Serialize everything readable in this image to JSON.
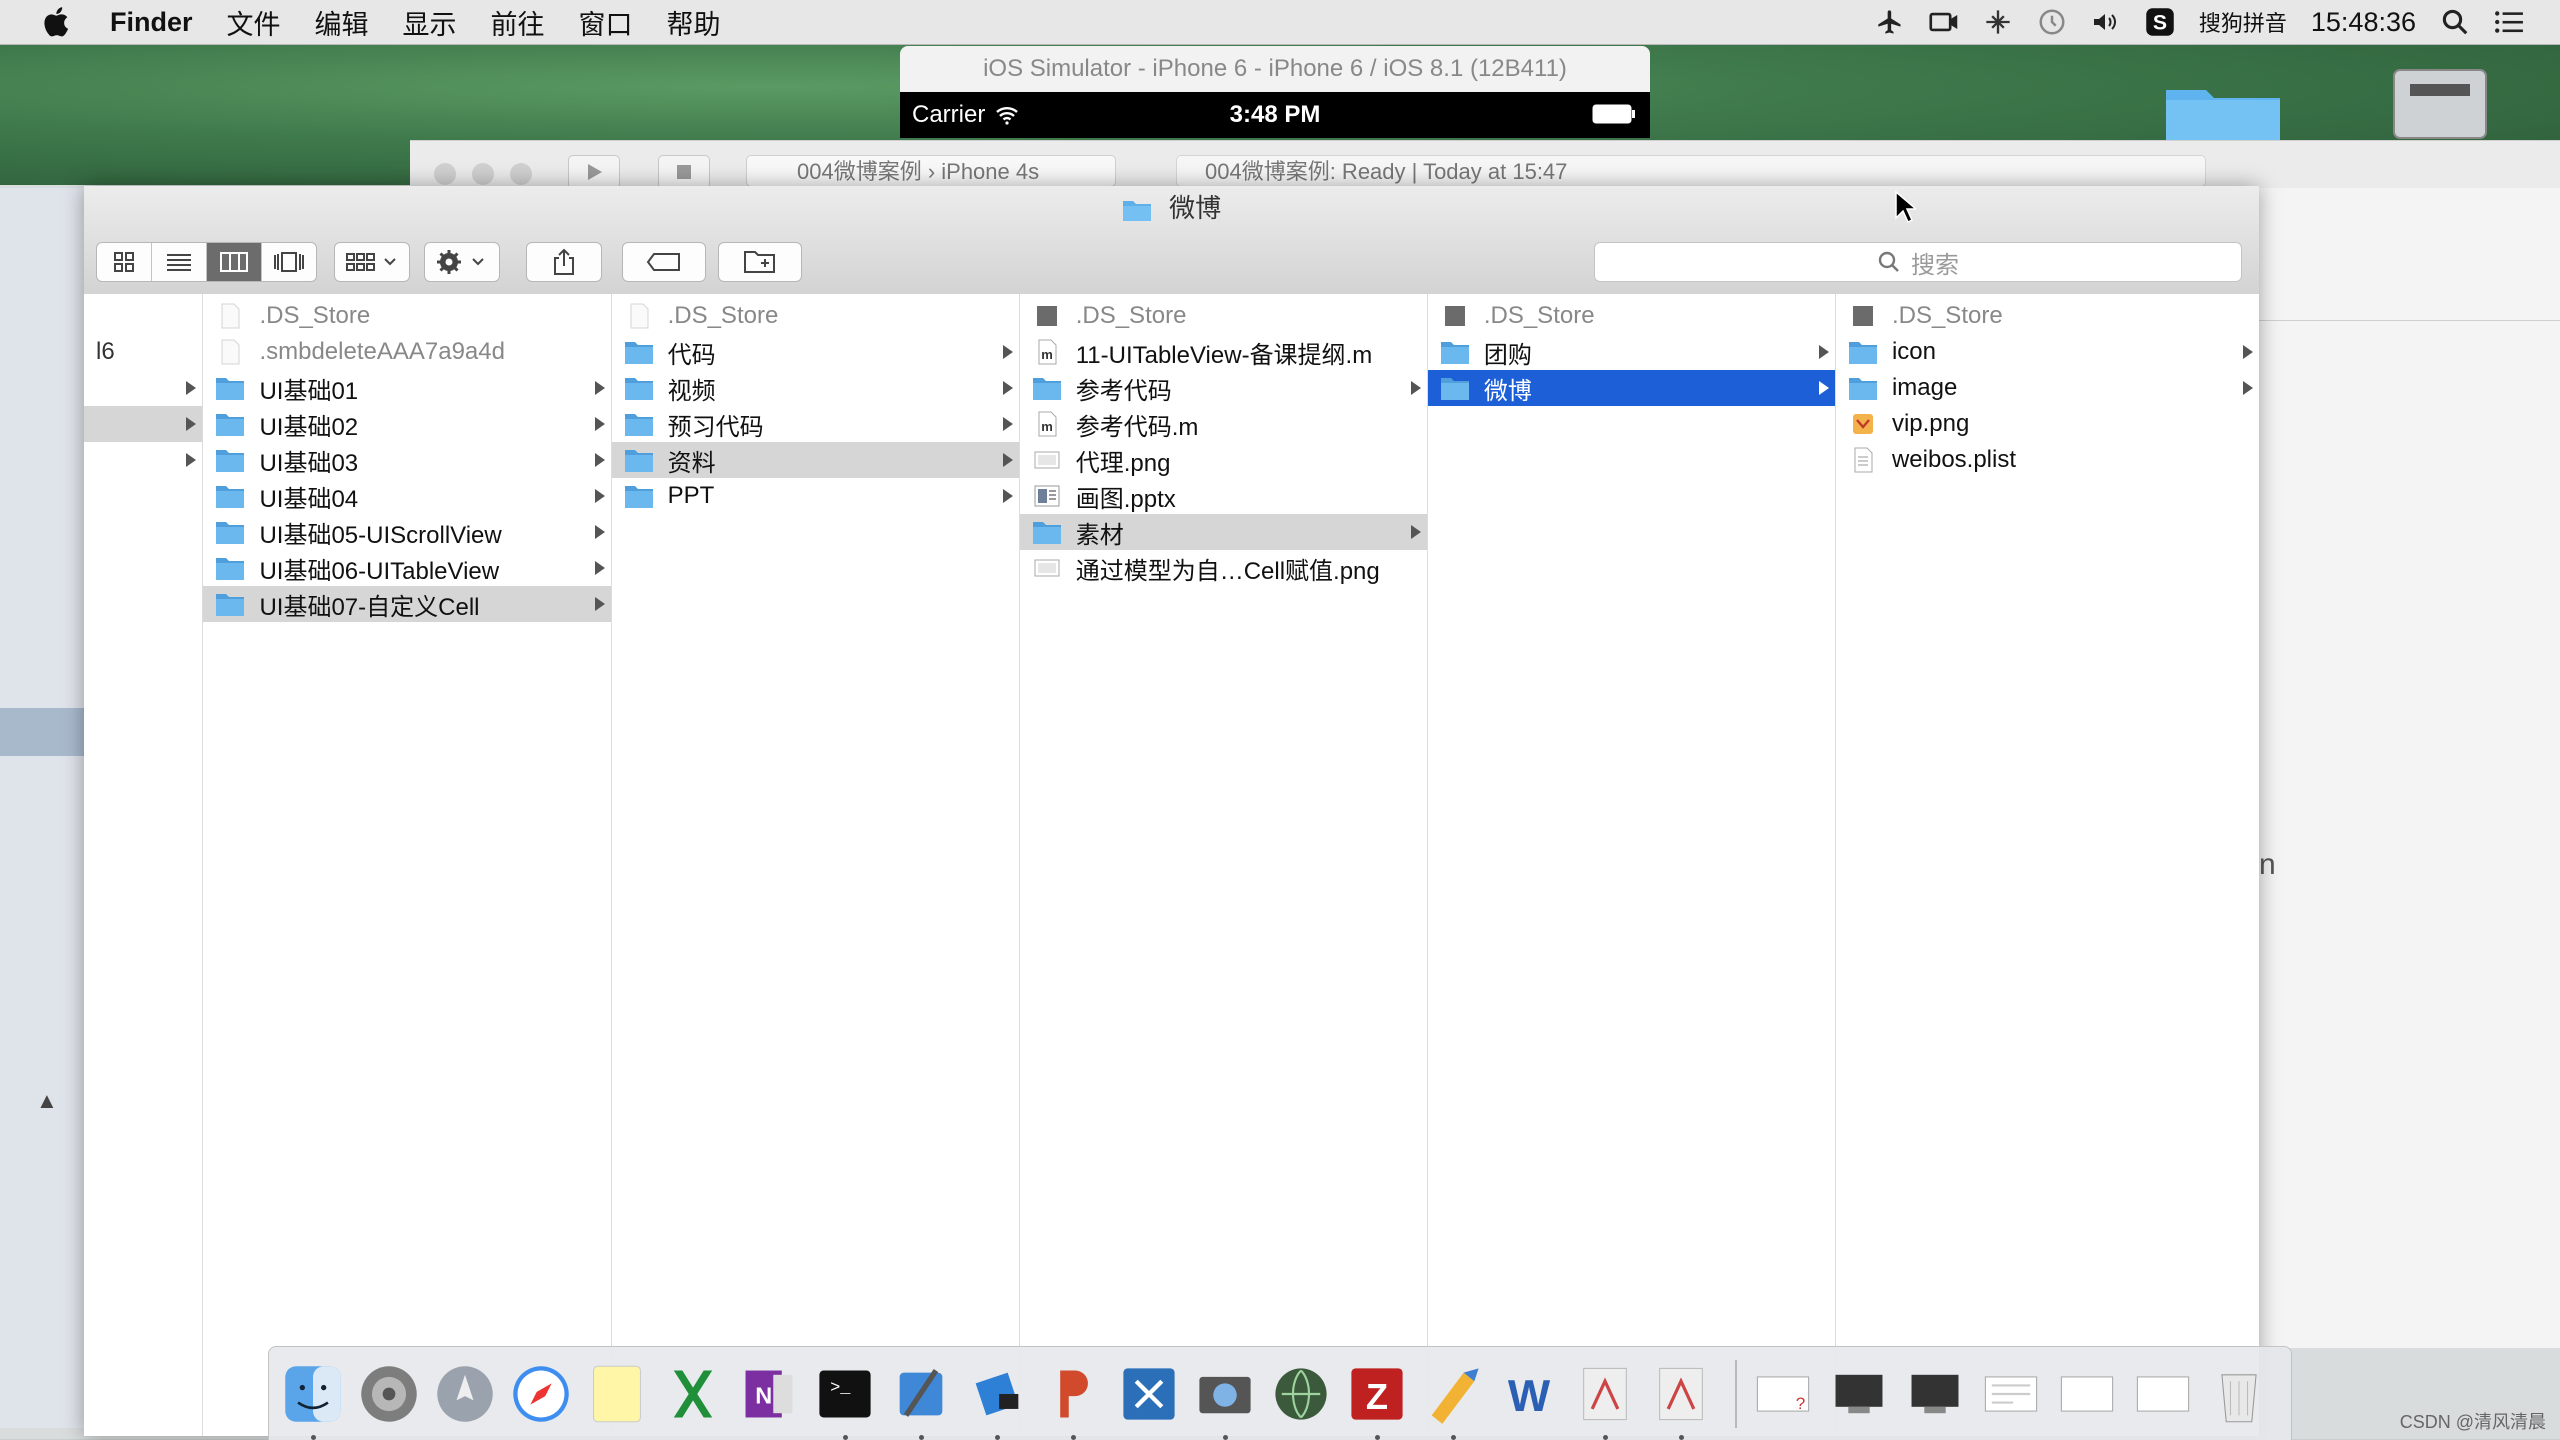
{
  "menubar": {
    "app_name": "Finder",
    "items": [
      "文件",
      "编辑",
      "显示",
      "前往",
      "窗口",
      "帮助"
    ],
    "ime_label": "搜狗拼音",
    "clock": "15:48:36"
  },
  "simulator": {
    "title": "iOS Simulator - iPhone 6 - iPhone 6 / iOS 8.1 (12B411)",
    "carrier": "Carrier",
    "time": "3:48 PM"
  },
  "xcode": {
    "scheme": "004微博案例 › iPhone 4s",
    "activity": "004微博案例: Ready  |  Today at 15:47"
  },
  "finder": {
    "window_title": "微博",
    "search_placeholder": "搜索",
    "first_column_partial": "l6",
    "columns": [
      {
        "items": [
          {
            "label": ".DS_Store",
            "type": "file-hidden",
            "dim": true
          },
          {
            "label": ".smbdeleteAAA7a9a4d",
            "type": "file-hidden",
            "dim": true
          },
          {
            "label": "UI基础01",
            "type": "folder",
            "arrow": true
          },
          {
            "label": "UI基础02",
            "type": "folder",
            "arrow": true
          },
          {
            "label": "UI基础03",
            "type": "folder",
            "arrow": true
          },
          {
            "label": "UI基础04",
            "type": "folder",
            "arrow": true
          },
          {
            "label": "UI基础05-UIScrollView",
            "type": "folder",
            "arrow": true
          },
          {
            "label": "UI基础06-UITableView",
            "type": "folder",
            "arrow": true
          },
          {
            "label": "UI基础07-自定义Cell",
            "type": "folder",
            "arrow": true,
            "selected": "gray"
          }
        ]
      },
      {
        "items": [
          {
            "label": ".DS_Store",
            "type": "file-hidden",
            "dim": true
          },
          {
            "label": "代码",
            "type": "folder",
            "arrow": true
          },
          {
            "label": "视频",
            "type": "folder",
            "arrow": true
          },
          {
            "label": "预习代码",
            "type": "folder",
            "arrow": true
          },
          {
            "label": "资料",
            "type": "folder",
            "arrow": true,
            "selected": "gray"
          },
          {
            "label": "PPT",
            "type": "folder",
            "arrow": true
          }
        ]
      },
      {
        "items": [
          {
            "label": ".DS_Store",
            "type": "file-dark",
            "dim": true
          },
          {
            "label": "11-UITableView-备课提纲.m",
            "type": "file-m"
          },
          {
            "label": "参考代码",
            "type": "folder",
            "arrow": true
          },
          {
            "label": "参考代码.m",
            "type": "file-m"
          },
          {
            "label": "代理.png",
            "type": "file-png"
          },
          {
            "label": "画图.pptx",
            "type": "file-pptx"
          },
          {
            "label": "素材",
            "type": "folder",
            "arrow": true,
            "selected": "gray"
          },
          {
            "label": "通过模型为自…Cell赋值.png",
            "type": "file-png"
          }
        ]
      },
      {
        "items": [
          {
            "label": ".DS_Store",
            "type": "file-dark",
            "dim": true
          },
          {
            "label": "团购",
            "type": "folder",
            "arrow": true
          },
          {
            "label": "微博",
            "type": "folder",
            "arrow": true,
            "selected": "blue"
          }
        ]
      },
      {
        "items": [
          {
            "label": ".DS_Store",
            "type": "file-dark",
            "dim": true
          },
          {
            "label": "icon",
            "type": "folder",
            "arrow": true
          },
          {
            "label": "image",
            "type": "folder",
            "arrow": true
          },
          {
            "label": "vip.png",
            "type": "file-vip"
          },
          {
            "label": "weibos.plist",
            "type": "file-plist"
          }
        ]
      }
    ]
  },
  "dock": {
    "apps": [
      "finder",
      "system-preferences",
      "launchpad",
      "safari",
      "notes",
      "excel",
      "onenote",
      "terminal",
      "xcode",
      "instruments",
      "powerpoint",
      "tools",
      "photo-app",
      "network-app",
      "filezilla",
      "utilities",
      "word",
      "textedit-a",
      "textedit-b"
    ],
    "docs": [
      "doc-1",
      "doc-2",
      "doc-3",
      "doc-4",
      "doc-5",
      "doc-6",
      "trash"
    ]
  },
  "watermark": "CSDN @清风清晨",
  "colors": {
    "selection_blue": "#1d5fd6",
    "selection_gray": "#d6d6d6",
    "folder_blue": "#5fb0e8"
  }
}
